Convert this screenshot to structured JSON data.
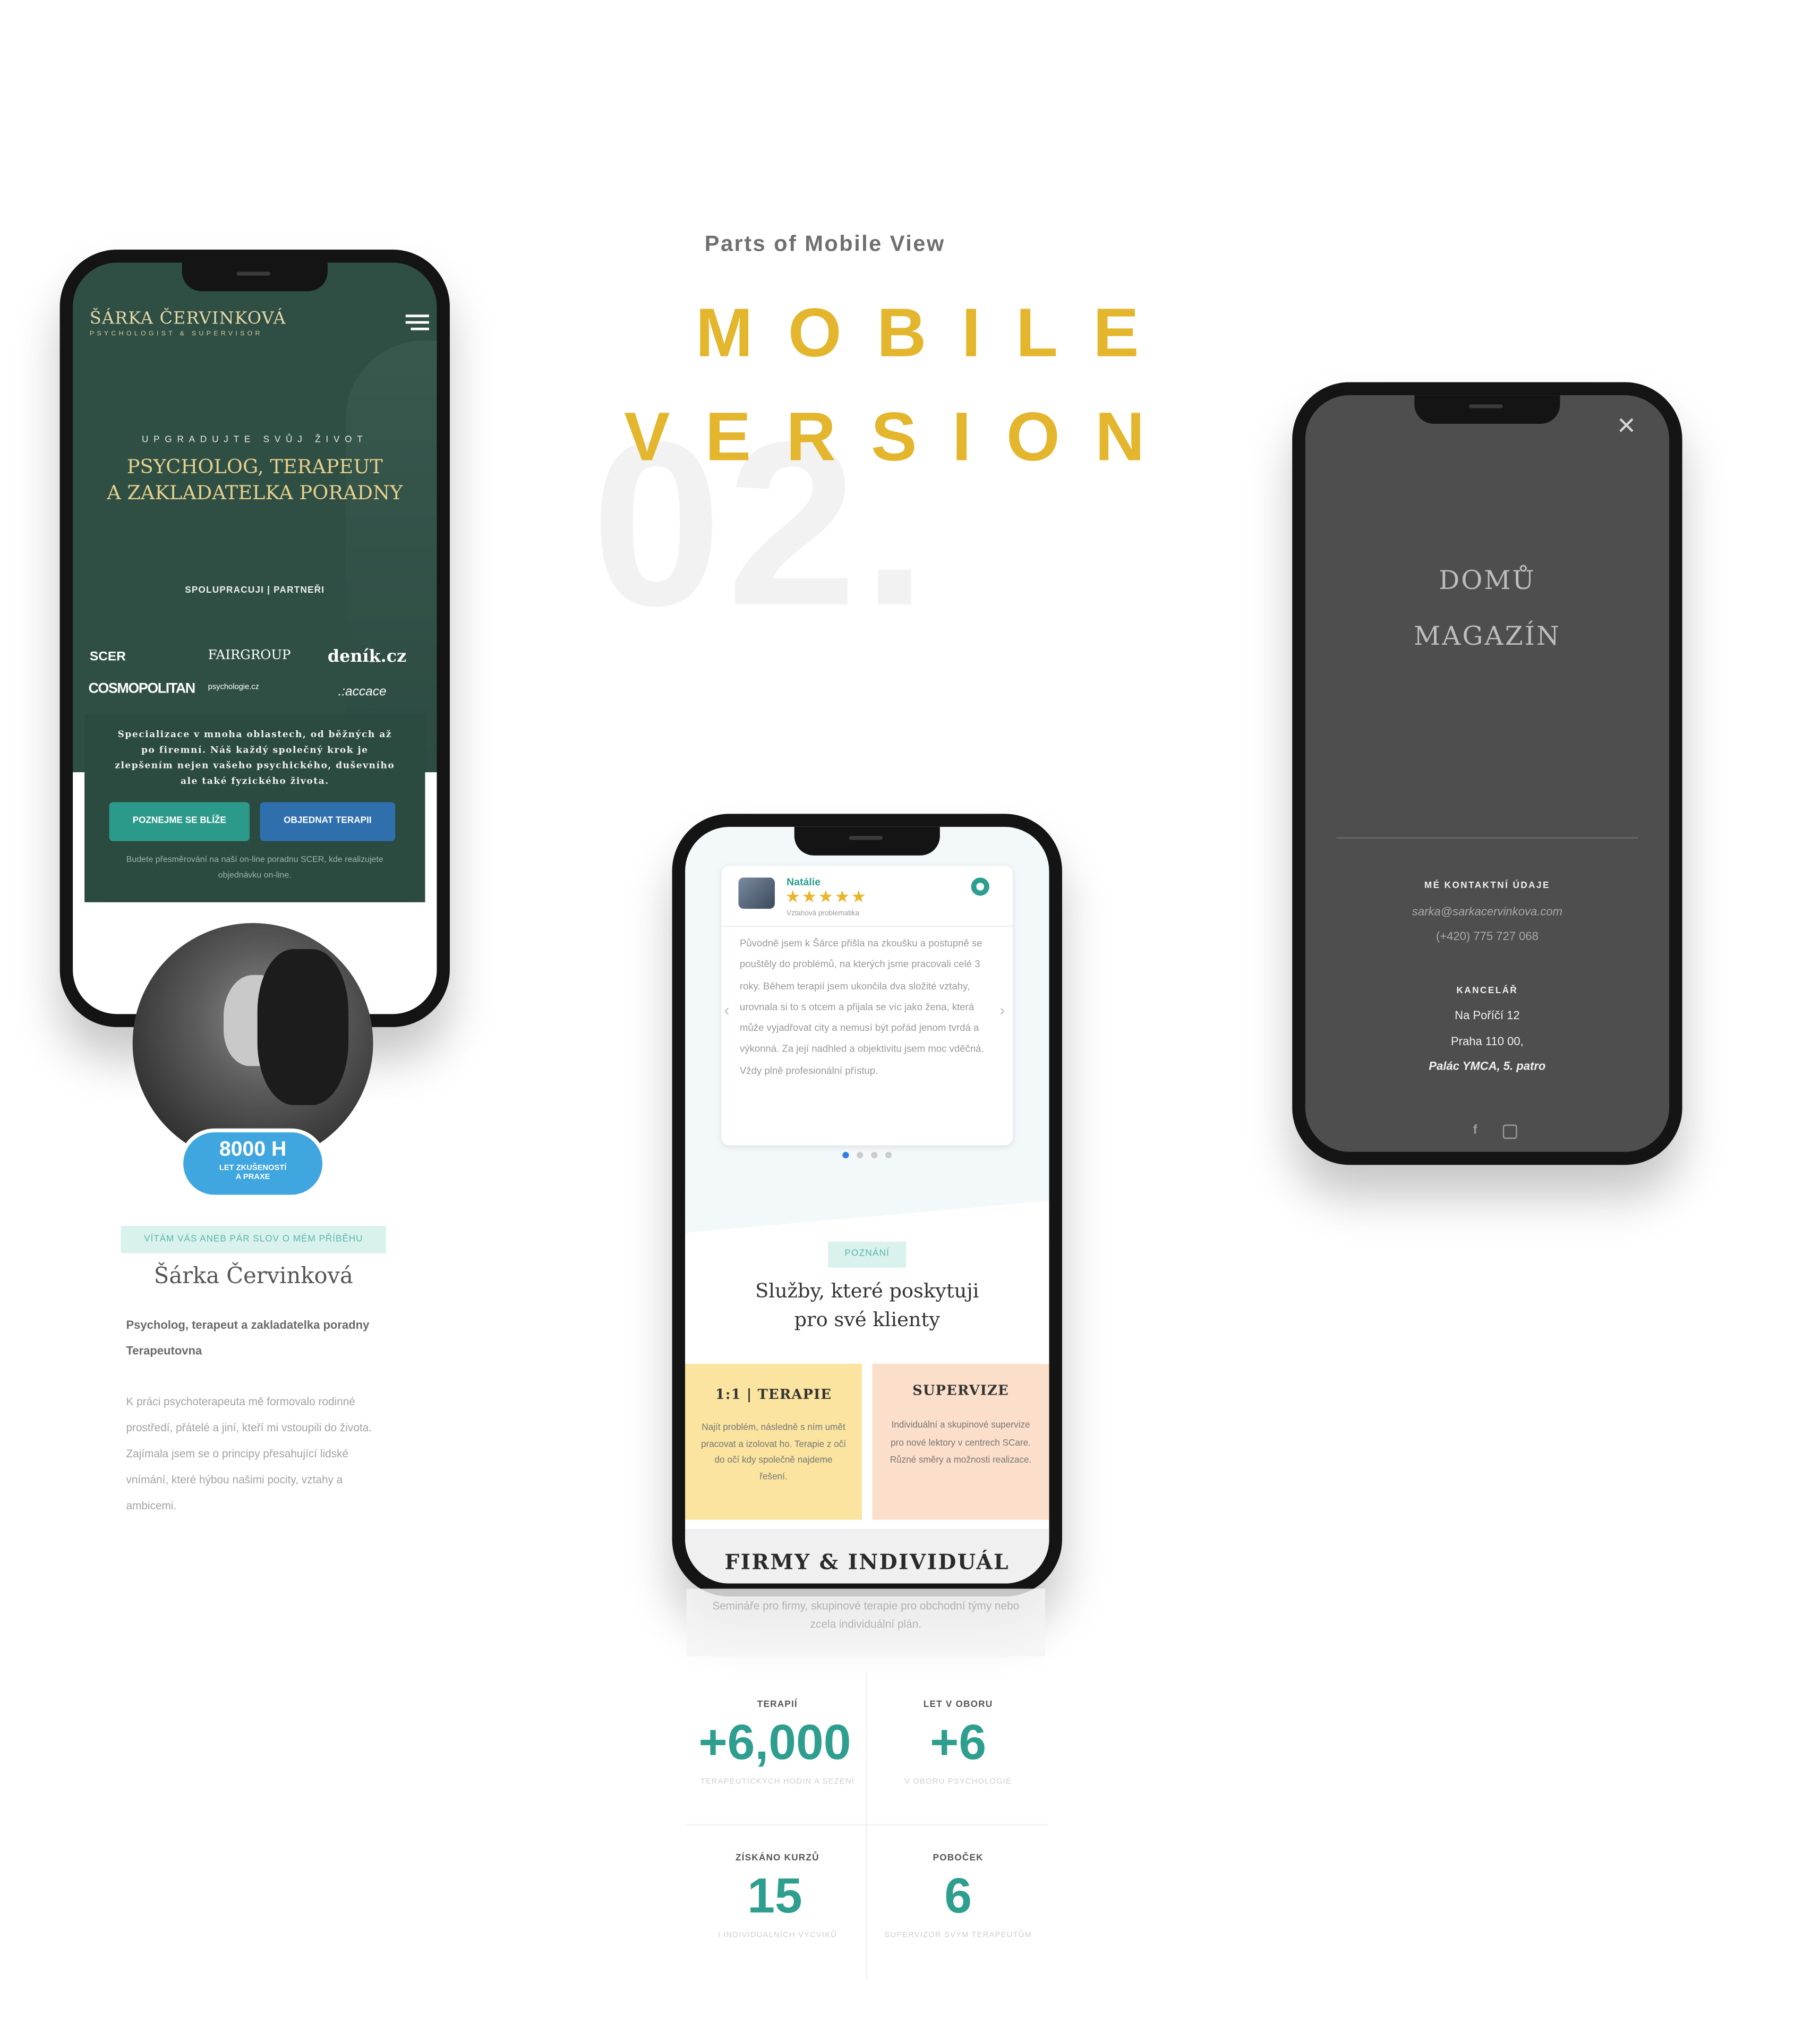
{
  "header": {
    "subtitle": "Parts of Mobile View",
    "title_line1": "MOBILE",
    "title_line2": "VERSION",
    "section_number": "02."
  },
  "phone_home": {
    "logo_name": "ŠÁRKA ČERVINKOVÁ",
    "logo_tagline": "PSYCHOLOGIST & SUPERVISOR",
    "menu_icon": "hamburger-icon",
    "hero_kicker": "UPGRADUJTE SVŮJ ŽIVOT",
    "hero_title_line1": "PSYCHOLOG, TERAPEUT",
    "hero_title_line2": "A ZAKLADATELKA PORADNY",
    "partners_label": "SPOLUPRACUJI | PARTNEŘI",
    "partners": {
      "scer": "SCER",
      "fairgroup": "FAIRGROUP",
      "denik": "deník.cz",
      "cosmopolitan": "COSMOPOLITAN",
      "psychologie": "psychologie.cz",
      "accace": ".:accace"
    },
    "intro_text": "Specializace v mnoha oblastech, od běžných až po firemní. Náš každý společný krok je zlepšením nejen vašeho psychického, duševního ale také fyzického života.",
    "btn_about": "POZNEJME SE BLÍŽE",
    "btn_order": "OBJEDNAT TERAPII",
    "redirect_note": "Budete přesměrování na naší on-line poradnu SCER, kde realizujete objednávku on-line."
  },
  "about": {
    "experience_value": "8000 H",
    "experience_label": "LET ZKUŠENOSTÍ A PRAXE",
    "welcome_badge": "VÍTÁM VÁS ANEB PÁR SLOV O MÉM PŘÍBĚHU",
    "name": "Šárka Červinková",
    "role": "Psycholog, terapeut a zakladatelka poradny",
    "org": "Terapeutovna",
    "bio": "K práci psychoterapeuta mě formovalo rodinné prostředí, přátelé a jiní, kteří mi vstoupili do života. Zajímala jsem se o principy přesahující lidské vnímání, které hýbou našimi pocity, vztahy a ambicemi."
  },
  "phone_services": {
    "review": {
      "author": "Natálie",
      "stars": "★★★★★",
      "topic": "Vztahová problematika",
      "text": "Původně jsem k Šárce přišla na zkoušku a postupně se pouštěly do problémů, na kterých jsme pracovali celé 3 roky. Během terapií jsem ukončila dva složité vztahy, urovnala si to s otcem a přijala se víc jako žena, která může vyjadřovat city a nemusí být pořád jenom tvrdá a výkonná. Za její nadhled a objektivitu jsem moc vděčná. Vždy plně profesionální přístup."
    },
    "badge": "POZNÁNÍ",
    "heading_line1": "Služby, které poskytuji",
    "heading_line2": "pro své klienty",
    "service1_title": "1:1 | TERAPIE",
    "service1_text": "Najít problém, následně s ním umět pracovat a izolovat ho. Terapie z očí do očí kdy společně najdeme řešení.",
    "service2_title": "SUPERVIZE",
    "service2_text": "Individuální a skupinové supervize pro nové lektory v centrech SCare. Různé směry a možnosti realizace.",
    "service3_title": "FIRMY & INDIVIDUÁL",
    "service3_text": "Semináře pro firmy, skupinové terapie pro obchodní týmy nebo zcela individuální plán."
  },
  "stats": [
    {
      "label": "TERAPIÍ",
      "value": "+6,000",
      "sub": "TERAPEUTICKÝCH HODIN A SEZENÍ"
    },
    {
      "label": "LET V OBORU",
      "value": "+6",
      "sub": "V OBORU PSYCHOLOGIE"
    },
    {
      "label": "ZÍSKÁNO KURZŮ",
      "value": "15",
      "sub": "I INDIVIDUÁLNÍCH VÝCVIKŮ"
    },
    {
      "label": "POBOČEK",
      "value": "6",
      "sub": "SUPERVIZOR SVÝM TERAPEUTŮM"
    }
  ],
  "phone_menu": {
    "close_icon": "close-icon",
    "nav_home": "DOMŮ",
    "nav_magazine": "MAGAZÍN",
    "contact_heading": "MÉ KONTAKTNÍ ÚDAJE",
    "email": "sarka@sarkacervinkova.com",
    "phone": "(+420) 775 727 068",
    "office_heading": "KANCELÁŘ",
    "address_line1": "Na Poříčí 12",
    "address_line2": "Praha 110 00,",
    "address_line3": "Palác YMCA, 5. patro",
    "social": [
      "facebook-icon",
      "linkedin-icon"
    ]
  },
  "colors": {
    "accent_yellow": "#e3b62e",
    "teal": "#2e9e8e",
    "dark_green": "#2f4f45",
    "blue": "#2f6fae",
    "menu_gray": "#4e4e4e"
  }
}
